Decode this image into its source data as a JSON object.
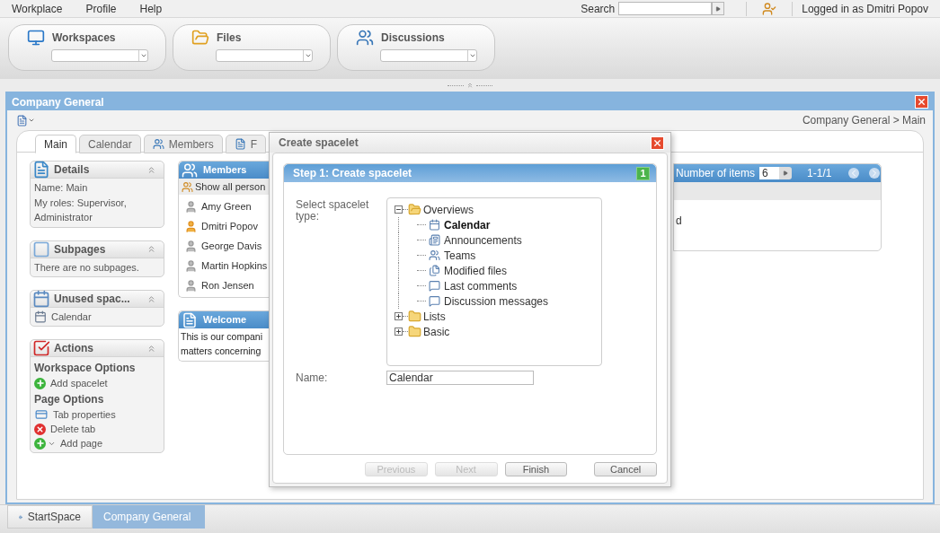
{
  "menu": [
    {
      "label": "Workplace"
    },
    {
      "label": "Profile"
    },
    {
      "label": "Help"
    }
  ],
  "search": {
    "label": "Search"
  },
  "user": {
    "text": "Logged in as Dmitri Popov"
  },
  "launchers": [
    {
      "label": "Workspaces",
      "kind": "workspaces"
    },
    {
      "label": "Files",
      "kind": "files"
    },
    {
      "label": "Discussions",
      "kind": "discussions"
    }
  ],
  "window": {
    "title": "Company General",
    "breadcrumb": "Company General > Main"
  },
  "tabs": [
    {
      "label": "Main",
      "selected": true,
      "kind": "plain"
    },
    {
      "label": "Calendar",
      "selected": false,
      "kind": "plain"
    },
    {
      "label": "Members",
      "selected": false,
      "kind": "members"
    },
    {
      "label": "F",
      "selected": false,
      "kind": "file"
    }
  ],
  "widgets": [
    {
      "title": "Details",
      "kind": "details",
      "lines": [
        "Name: Main",
        "My roles: Supervisor, Administrator"
      ]
    },
    {
      "title": "Subpages",
      "kind": "subpages",
      "lines": [
        "There are no subpages."
      ]
    },
    {
      "title": "Unused spac...",
      "kind": "unused",
      "items": [
        {
          "label": "Calendar",
          "kind": "calendar"
        }
      ]
    },
    {
      "title": "Actions",
      "kind": "actions",
      "items": [
        {
          "label": "Workspace Options",
          "kind": "heading"
        },
        {
          "label": "Add spacelet",
          "kind": "add"
        },
        {
          "label": "Page Options",
          "kind": "heading"
        },
        {
          "label": "Tab properties",
          "kind": "tab"
        },
        {
          "label": "Delete tab",
          "kind": "delete"
        },
        {
          "label": "Add page",
          "kind": "addmenu"
        }
      ]
    }
  ],
  "members_panel": {
    "title": "Members",
    "show_all": "Show all person",
    "people": [
      {
        "name": "Amy Green",
        "current": false
      },
      {
        "name": "Dmitri Popov",
        "current": true
      },
      {
        "name": "George Davis",
        "current": false
      },
      {
        "name": "Martin Hopkins",
        "current": false
      },
      {
        "name": "Ron Jensen",
        "current": false
      }
    ]
  },
  "welcome_panel": {
    "title": "Welcome",
    "lines": [
      "This is our compani",
      "matters concerning"
    ]
  },
  "list_panel": {
    "label": "Number of items",
    "value": "6",
    "range": "1-1/1",
    "cell": "d"
  },
  "dialog": {
    "title": "Create spacelet",
    "step": "Step 1: Create spacelet",
    "step_number": "1",
    "type_label": "Select spacelet type:",
    "tree": [
      {
        "label": "Overviews",
        "expanded": true,
        "children": [
          {
            "label": "Calendar",
            "selected": true
          },
          {
            "label": "Announcements",
            "selected": false
          },
          {
            "label": "Teams",
            "selected": false
          },
          {
            "label": "Modified files",
            "selected": false
          },
          {
            "label": "Last comments",
            "selected": false
          },
          {
            "label": "Discussion messages",
            "selected": false
          }
        ]
      },
      {
        "label": "Lists",
        "expanded": false
      },
      {
        "label": "Basic",
        "expanded": false
      }
    ],
    "name_label": "Name:",
    "name_value": "Calendar",
    "buttons": [
      {
        "label": "Previous",
        "disabled": true
      },
      {
        "label": "Next",
        "disabled": true
      },
      {
        "label": "Finish",
        "disabled": false
      },
      {
        "label": "Cancel",
        "disabled": false
      }
    ]
  },
  "taskbar": [
    {
      "label": "StartSpace",
      "selected": false
    },
    {
      "label": "Company General",
      "selected": true
    }
  ]
}
